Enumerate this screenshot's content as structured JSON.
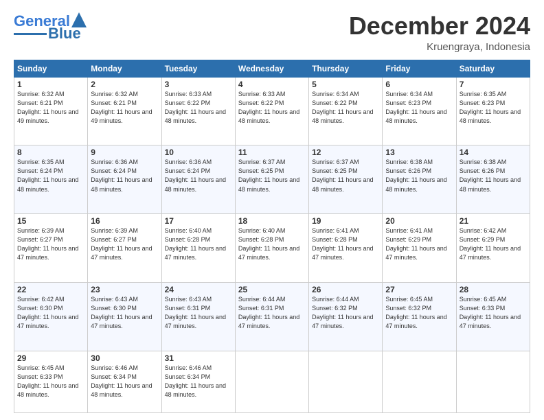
{
  "header": {
    "logo": {
      "line1": "General",
      "line2": "Blue"
    },
    "title": "December 2024",
    "location": "Kruengraya, Indonesia"
  },
  "days_of_week": [
    "Sunday",
    "Monday",
    "Tuesday",
    "Wednesday",
    "Thursday",
    "Friday",
    "Saturday"
  ],
  "weeks": [
    [
      {
        "day": 1,
        "sunrise": "6:32 AM",
        "sunset": "6:21 PM",
        "daylight": "11 hours and 49 minutes."
      },
      {
        "day": 2,
        "sunrise": "6:32 AM",
        "sunset": "6:21 PM",
        "daylight": "11 hours and 49 minutes."
      },
      {
        "day": 3,
        "sunrise": "6:33 AM",
        "sunset": "6:22 PM",
        "daylight": "11 hours and 48 minutes."
      },
      {
        "day": 4,
        "sunrise": "6:33 AM",
        "sunset": "6:22 PM",
        "daylight": "11 hours and 48 minutes."
      },
      {
        "day": 5,
        "sunrise": "6:34 AM",
        "sunset": "6:22 PM",
        "daylight": "11 hours and 48 minutes."
      },
      {
        "day": 6,
        "sunrise": "6:34 AM",
        "sunset": "6:23 PM",
        "daylight": "11 hours and 48 minutes."
      },
      {
        "day": 7,
        "sunrise": "6:35 AM",
        "sunset": "6:23 PM",
        "daylight": "11 hours and 48 minutes."
      }
    ],
    [
      {
        "day": 8,
        "sunrise": "6:35 AM",
        "sunset": "6:24 PM",
        "daylight": "11 hours and 48 minutes."
      },
      {
        "day": 9,
        "sunrise": "6:36 AM",
        "sunset": "6:24 PM",
        "daylight": "11 hours and 48 minutes."
      },
      {
        "day": 10,
        "sunrise": "6:36 AM",
        "sunset": "6:24 PM",
        "daylight": "11 hours and 48 minutes."
      },
      {
        "day": 11,
        "sunrise": "6:37 AM",
        "sunset": "6:25 PM",
        "daylight": "11 hours and 48 minutes."
      },
      {
        "day": 12,
        "sunrise": "6:37 AM",
        "sunset": "6:25 PM",
        "daylight": "11 hours and 48 minutes."
      },
      {
        "day": 13,
        "sunrise": "6:38 AM",
        "sunset": "6:26 PM",
        "daylight": "11 hours and 48 minutes."
      },
      {
        "day": 14,
        "sunrise": "6:38 AM",
        "sunset": "6:26 PM",
        "daylight": "11 hours and 48 minutes."
      }
    ],
    [
      {
        "day": 15,
        "sunrise": "6:39 AM",
        "sunset": "6:27 PM",
        "daylight": "11 hours and 47 minutes."
      },
      {
        "day": 16,
        "sunrise": "6:39 AM",
        "sunset": "6:27 PM",
        "daylight": "11 hours and 47 minutes."
      },
      {
        "day": 17,
        "sunrise": "6:40 AM",
        "sunset": "6:28 PM",
        "daylight": "11 hours and 47 minutes."
      },
      {
        "day": 18,
        "sunrise": "6:40 AM",
        "sunset": "6:28 PM",
        "daylight": "11 hours and 47 minutes."
      },
      {
        "day": 19,
        "sunrise": "6:41 AM",
        "sunset": "6:28 PM",
        "daylight": "11 hours and 47 minutes."
      },
      {
        "day": 20,
        "sunrise": "6:41 AM",
        "sunset": "6:29 PM",
        "daylight": "11 hours and 47 minutes."
      },
      {
        "day": 21,
        "sunrise": "6:42 AM",
        "sunset": "6:29 PM",
        "daylight": "11 hours and 47 minutes."
      }
    ],
    [
      {
        "day": 22,
        "sunrise": "6:42 AM",
        "sunset": "6:30 PM",
        "daylight": "11 hours and 47 minutes."
      },
      {
        "day": 23,
        "sunrise": "6:43 AM",
        "sunset": "6:30 PM",
        "daylight": "11 hours and 47 minutes."
      },
      {
        "day": 24,
        "sunrise": "6:43 AM",
        "sunset": "6:31 PM",
        "daylight": "11 hours and 47 minutes."
      },
      {
        "day": 25,
        "sunrise": "6:44 AM",
        "sunset": "6:31 PM",
        "daylight": "11 hours and 47 minutes."
      },
      {
        "day": 26,
        "sunrise": "6:44 AM",
        "sunset": "6:32 PM",
        "daylight": "11 hours and 47 minutes."
      },
      {
        "day": 27,
        "sunrise": "6:45 AM",
        "sunset": "6:32 PM",
        "daylight": "11 hours and 47 minutes."
      },
      {
        "day": 28,
        "sunrise": "6:45 AM",
        "sunset": "6:33 PM",
        "daylight": "11 hours and 47 minutes."
      }
    ],
    [
      {
        "day": 29,
        "sunrise": "6:45 AM",
        "sunset": "6:33 PM",
        "daylight": "11 hours and 48 minutes."
      },
      {
        "day": 30,
        "sunrise": "6:46 AM",
        "sunset": "6:34 PM",
        "daylight": "11 hours and 48 minutes."
      },
      {
        "day": 31,
        "sunrise": "6:46 AM",
        "sunset": "6:34 PM",
        "daylight": "11 hours and 48 minutes."
      },
      null,
      null,
      null,
      null
    ]
  ]
}
